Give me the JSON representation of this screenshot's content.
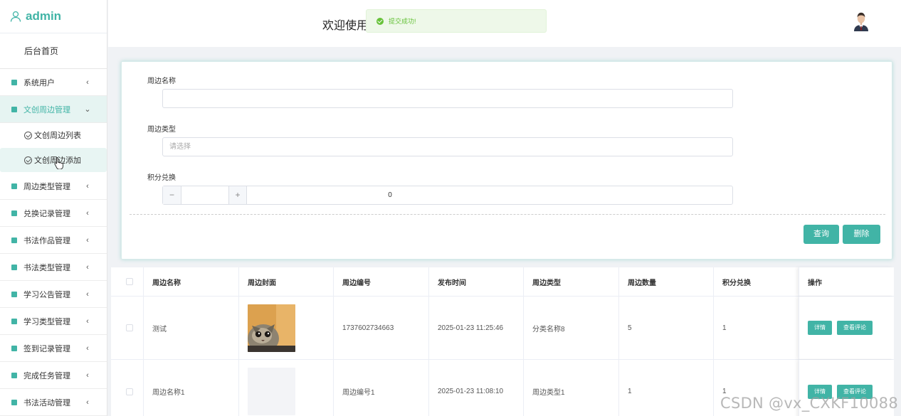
{
  "brand": {
    "title": "admin"
  },
  "sidebar": {
    "home": "后台首页",
    "items": [
      {
        "label": "系统用户",
        "chevron": "‹"
      },
      {
        "label": "文创周边管理",
        "chevron": "⌄",
        "active": true
      },
      {
        "label": "周边类型管理",
        "chevron": "‹"
      },
      {
        "label": "兑换记录管理",
        "chevron": "‹"
      },
      {
        "label": "书法作品管理",
        "chevron": "‹"
      },
      {
        "label": "书法类型管理",
        "chevron": "‹"
      },
      {
        "label": "学习公告管理",
        "chevron": "‹"
      },
      {
        "label": "学习类型管理",
        "chevron": "‹"
      },
      {
        "label": "签到记录管理",
        "chevron": "‹"
      },
      {
        "label": "完成任务管理",
        "chevron": "‹"
      },
      {
        "label": "书法活动管理",
        "chevron": "‹"
      }
    ],
    "subitems": [
      {
        "label": "文创周边列表"
      },
      {
        "label": "文创周边添加",
        "active": true
      }
    ]
  },
  "header": {
    "welcome": "欢迎使用"
  },
  "toast": {
    "message": "提交成功!"
  },
  "form": {
    "name_label": "周边名称",
    "name_value": "",
    "type_label": "周边类型",
    "type_placeholder": "请选择",
    "points_label": "积分兑换",
    "points_minus": "−",
    "points_plus": "+",
    "points_value": "0",
    "query_button": "查询",
    "delete_button": "删除"
  },
  "table": {
    "headers": [
      "周边名称",
      "周边封面",
      "周边编号",
      "发布时间",
      "周边类型",
      "周边数量",
      "积分兑换",
      "操作"
    ],
    "rows": [
      {
        "name": "测试",
        "code": "1737602734663",
        "time": "2025-01-23 11:25:46",
        "type": "分类名称8",
        "qty": "5",
        "points": "1"
      },
      {
        "name": "周边名称1",
        "code": "周边编号1",
        "time": "2025-01-23 11:08:10",
        "type": "周边类型1",
        "qty": "1",
        "points": "1"
      }
    ],
    "detail_button": "详情",
    "comment_button": "查看评论"
  },
  "watermark": "CSDN @vx_CXKF10088",
  "colors": {
    "accent": "#41b4a6",
    "success": "#67c23a"
  }
}
